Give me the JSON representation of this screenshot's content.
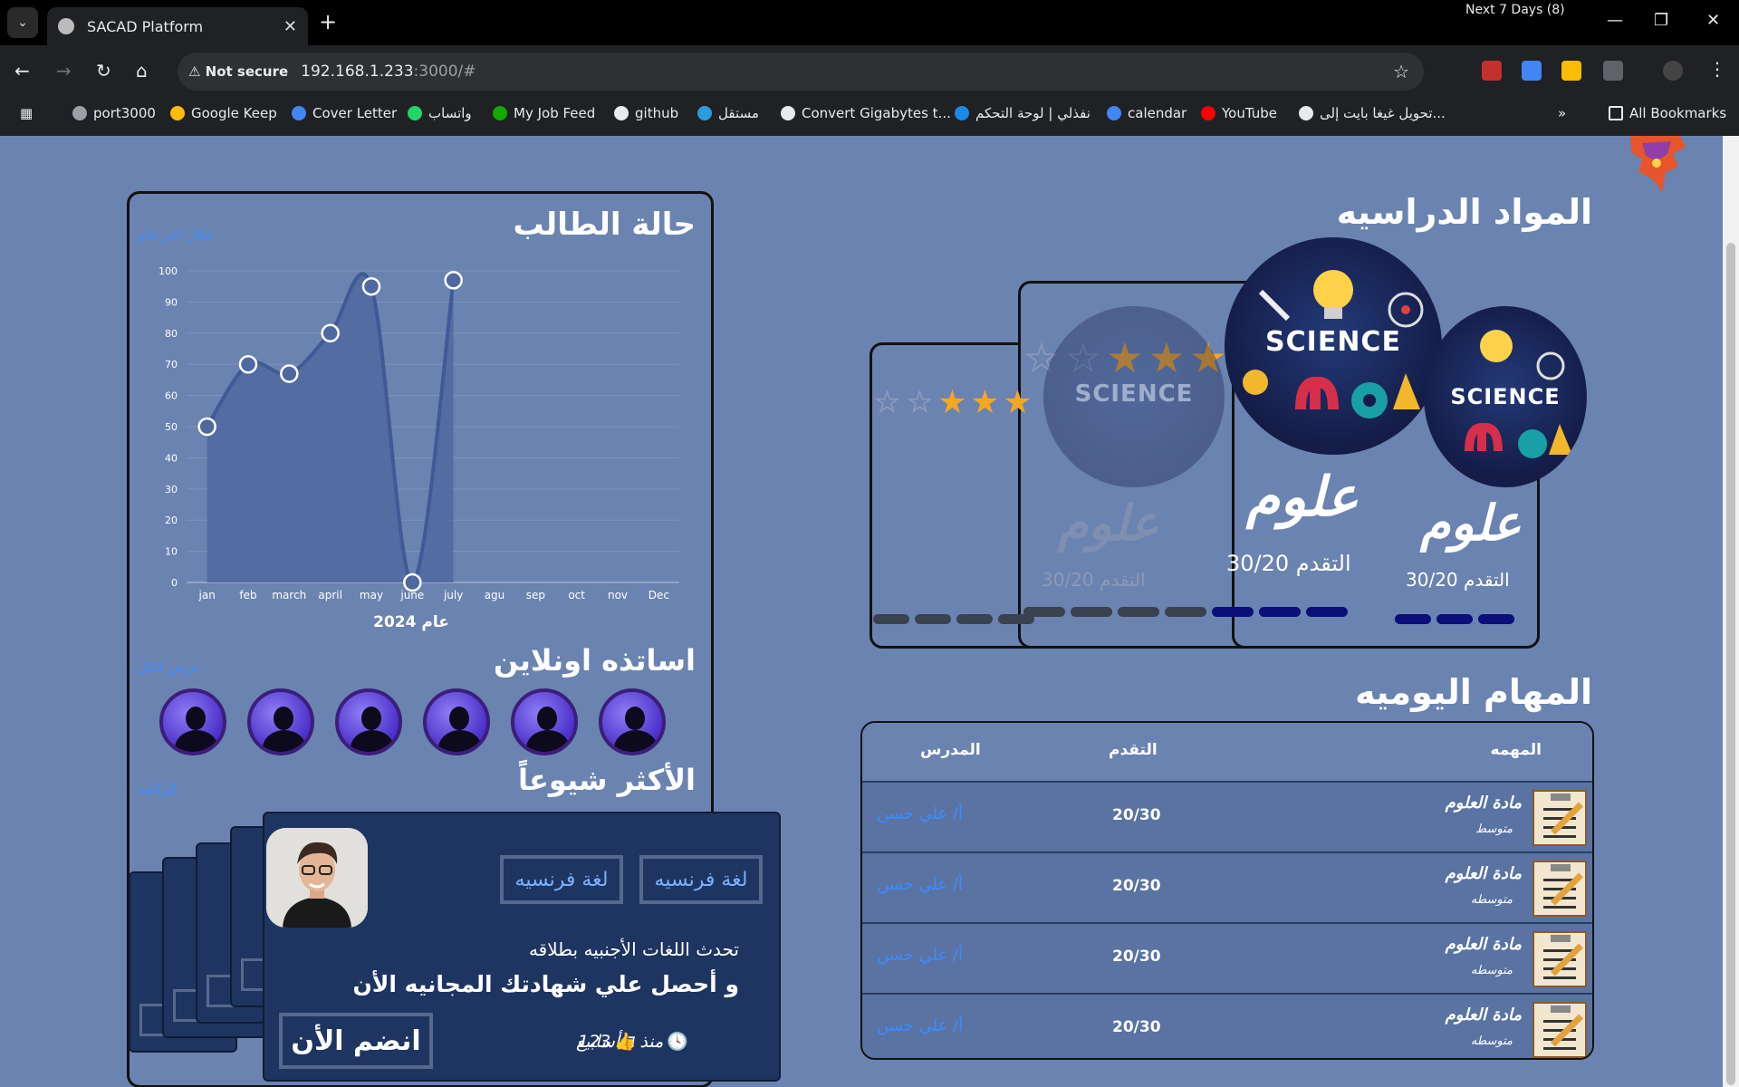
{
  "browser": {
    "tab_title": "SACAD Platform",
    "next_days": "Next 7 Days (8)",
    "security_label": "Not secure",
    "url_host": "192.168.1.233",
    "url_rest": ":3000/#",
    "bookmarks": [
      {
        "label": "port3000",
        "color": "#9aa0a6"
      },
      {
        "label": "Google Keep",
        "color": "#fbbc04"
      },
      {
        "label": "Cover Letter",
        "color": "#4285f4"
      },
      {
        "label": "واتساب",
        "color": "#25d366"
      },
      {
        "label": "My Job Feed",
        "color": "#14a800"
      },
      {
        "label": "github",
        "color": "#e8eaed"
      },
      {
        "label": "مستقل",
        "color": "#2d9cdb"
      },
      {
        "label": "Convert Gigabytes t...",
        "color": "#e8eaed"
      },
      {
        "label": "نفذلي | لوحة التحكم",
        "color": "#1e88e5"
      },
      {
        "label": "calendar",
        "color": "#4285f4"
      },
      {
        "label": "YouTube",
        "color": "#ff0000"
      },
      {
        "label": "تحويل غيغا بايت إلى...",
        "color": "#e8eaed"
      }
    ],
    "all_bookmarks": "All Bookmarks"
  },
  "student_status": {
    "title": "حالة الطالب",
    "period_link": "خلال اخر عام"
  },
  "chart_data": {
    "type": "area",
    "categories": [
      "jan",
      "feb",
      "march",
      "april",
      "may",
      "june",
      "july",
      "agu",
      "sep",
      "oct",
      "nov",
      "Dec"
    ],
    "values": [
      50,
      70,
      67,
      80,
      95,
      0,
      97,
      null,
      null,
      null,
      null,
      null
    ],
    "xlabel": "عام 2024",
    "ylim": [
      0,
      100
    ],
    "yticks": [
      0,
      10,
      20,
      30,
      40,
      50,
      60,
      70,
      80,
      90,
      100
    ],
    "grid": true,
    "fill_color": "#4f68a0",
    "line_color": "#3f5a96"
  },
  "teachers": {
    "title": "اساتذه اونلاين",
    "view_all": "عرض الكل",
    "count": 6
  },
  "popular": {
    "title": "الأكثر شيوعاً",
    "link": "الرائجه",
    "tag1": "لغة فرنسيه",
    "tag2": "لغة فرنسيه",
    "line1": "تحدث اللغات الأجنبيه بطلاقه",
    "line2": "و أحصل علي شهادتك المجانيه الأن",
    "join": "انضم الأن",
    "likes": "123",
    "time": "منذ ٦ أسابيع"
  },
  "subjects": {
    "title": "المواد الدراسيه",
    "cards": [
      {
        "name": "علوم",
        "progress": "التقدم 30/20",
        "circle_text": "SCIENCE"
      },
      {
        "name": "علوم",
        "progress": "التقدم 30/20",
        "circle_text": "SCIENCE"
      },
      {
        "name": "علوم",
        "progress": "التقدم 30/20",
        "circle_text": "SCIENCE"
      }
    ],
    "star_color": "#f5a623",
    "progress_color": "#0a0f7a"
  },
  "tasks": {
    "title": "المهام اليوميه",
    "headers": {
      "task": "المهمه",
      "progress": "التقدم",
      "teacher": "المدرس"
    },
    "rows": [
      {
        "title": "مادة العلوم",
        "level": "متوسط",
        "progress": "20/30",
        "teacher": "أ/ علي حسن"
      },
      {
        "title": "مادة العلوم",
        "level": "متوسطه",
        "progress": "20/30",
        "teacher": "أ/ علي حسن"
      },
      {
        "title": "مادة العلوم",
        "level": "متوسطه",
        "progress": "20/30",
        "teacher": "أ/ علي حسن"
      },
      {
        "title": "مادة العلوم",
        "level": "متوسطه",
        "progress": "20/30",
        "teacher": "أ/ علي حسن"
      }
    ]
  }
}
